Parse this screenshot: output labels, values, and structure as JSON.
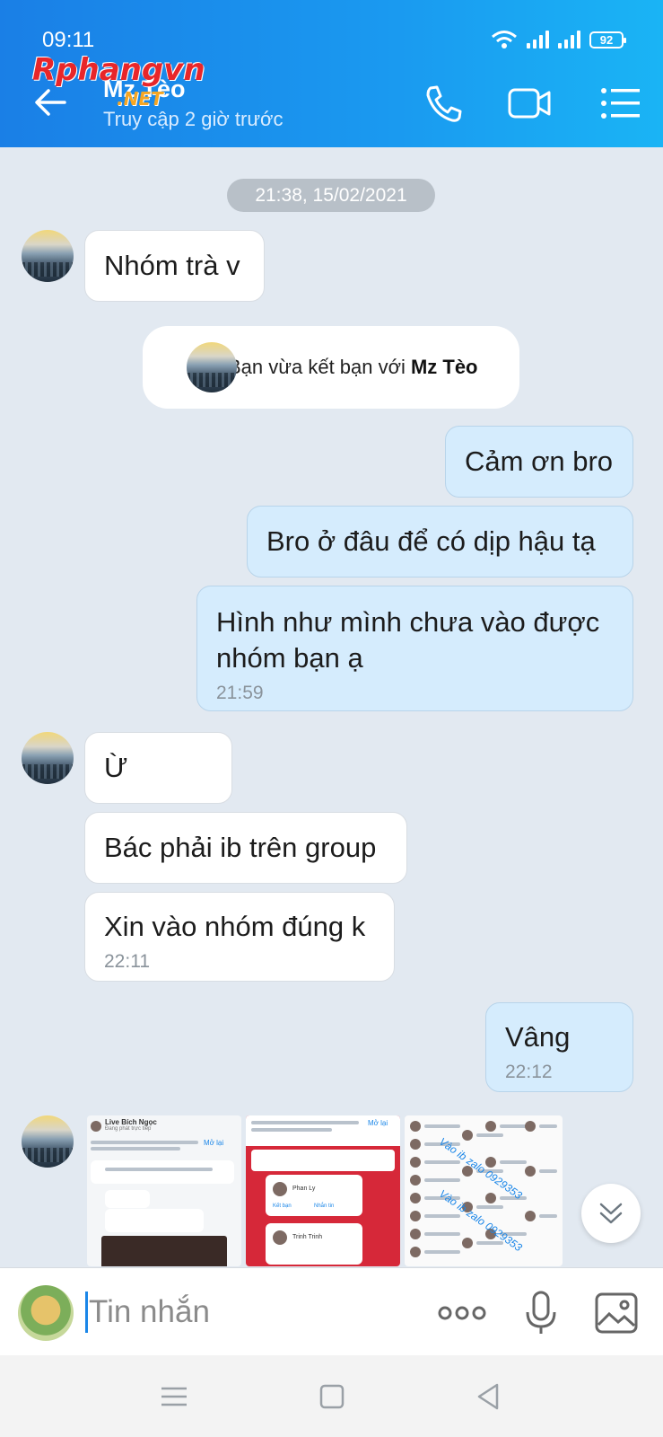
{
  "status_bar": {
    "time": "09:11",
    "battery": "92"
  },
  "header": {
    "contact_name": "Mz Tèo",
    "last_seen": "Truy cập 2 giờ trước",
    "watermark_main": "Rphangvn",
    "watermark_sub": ".NET"
  },
  "chat": {
    "date_separator": "21:38, 15/02/2021",
    "messages": [
      {
        "side": "in",
        "text": "Nhóm trà v"
      },
      {
        "side": "out",
        "text": "Cảm ơn bro"
      },
      {
        "side": "out",
        "text": "Bro ở đâu để có dịp hậu tạ"
      },
      {
        "side": "out",
        "text": "Hình như mình chưa vào được nhóm bạn ạ",
        "time": "21:59"
      },
      {
        "side": "in",
        "text": "Ừ"
      },
      {
        "side": "in",
        "text": "Bác phải ib trên group"
      },
      {
        "side": "in",
        "text": "Xin vào nhóm đúng k",
        "time": "22:11"
      },
      {
        "side": "out",
        "text": "Vâng",
        "time": "22:12"
      }
    ],
    "notice": {
      "text": "Bạn vừa kết bạn với",
      "name": "Mz Tèo"
    },
    "image_tiles": [
      {
        "title": "Live Bích Ngọc",
        "action": "Mở lại",
        "status": "Đang phát trực tiếp"
      },
      {
        "name1": "Phan Ly",
        "name2": "Trinh Trinh",
        "btn1": "Kết bạn",
        "btn2": "Nhắn tin",
        "action": "Mở lại"
      },
      {
        "overlay": "Vào ib zalo 0929353"
      }
    ]
  },
  "composer": {
    "placeholder": "Tin nhắn"
  },
  "colors": {
    "header_start": "#1a7fe6",
    "header_end": "#1ab4f5",
    "bubble_out": "#d5ecfd",
    "bubble_in": "#ffffff",
    "background": "#e2e9f1"
  }
}
